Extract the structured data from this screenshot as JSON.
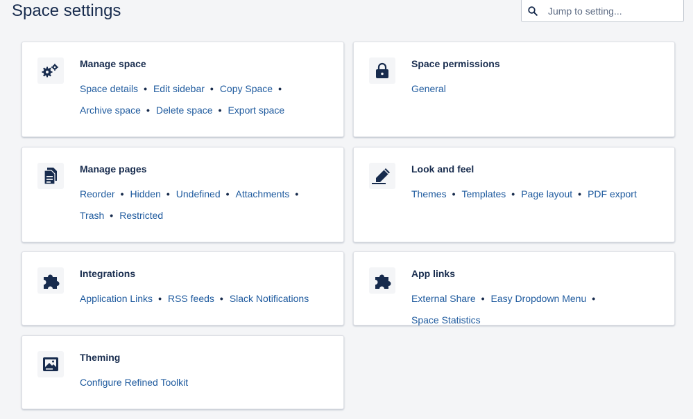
{
  "header": {
    "title": "Space settings",
    "search": {
      "placeholder": "Jump to setting...",
      "value": "",
      "icon": "search-icon"
    }
  },
  "colors": {
    "link": "#1e5a9e",
    "text": "#172b4d",
    "background": "#f4f5f7"
  },
  "cards": [
    {
      "id": "manage-space",
      "title": "Manage space",
      "icon": "gears-icon",
      "links": [
        "Space details",
        "Edit sidebar",
        "Copy Space",
        "Archive space",
        "Delete space",
        "Export space"
      ],
      "line_breaks_after": [
        2
      ]
    },
    {
      "id": "space-permissions",
      "title": "Space permissions",
      "icon": "lock-icon",
      "links": [
        "General"
      ]
    },
    {
      "id": "manage-pages",
      "title": "Manage pages",
      "icon": "document-icon",
      "links": [
        "Reorder",
        "Hidden",
        "Undefined",
        "Attachments",
        "Trash",
        "Restricted"
      ],
      "line_breaks_after": [
        3
      ]
    },
    {
      "id": "look-and-feel",
      "title": "Look and feel",
      "icon": "pencil-icon",
      "links": [
        "Themes",
        "Templates",
        "Page layout",
        "PDF export"
      ]
    },
    {
      "id": "integrations",
      "title": "Integrations",
      "icon": "puzzle-icon",
      "links": [
        "Application Links",
        "RSS feeds",
        "Slack Notifications"
      ]
    },
    {
      "id": "app-links",
      "title": "App links",
      "icon": "puzzle-icon",
      "links": [
        "External Share",
        "Easy Dropdown Menu",
        "Space Statistics"
      ]
    },
    {
      "id": "theming",
      "title": "Theming",
      "icon": "image-icon",
      "links": [
        "Configure Refined Toolkit"
      ]
    }
  ]
}
